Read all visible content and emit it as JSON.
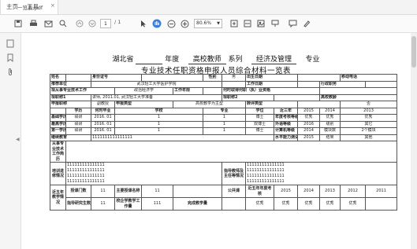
{
  "tabs": {
    "home": "主页",
    "tools": "工具",
    "doc": "一览表.pdf"
  },
  "toolbar": {
    "page_current": "1",
    "page_total": "/ 1",
    "zoom": "80.6%"
  },
  "icons": [
    "save-icon",
    "print-icon",
    "mail-icon",
    "search-icon",
    "page-up-icon",
    "page-down-icon",
    "select-cursor-icon",
    "hand-icon",
    "zoom-out-icon",
    "zoom-in-icon",
    "fit-page-icon",
    "fit-width-icon",
    "screenshot-icon",
    "annotate-icon",
    "comment-icon",
    "pen-icon",
    "pages-icon",
    "bookmark-icon",
    "attachment-icon"
  ],
  "document": {
    "title_line1": {
      "province": "湖北省",
      "year": "年度",
      "type": "高校教师",
      "series_label": "系列",
      "series": "经济及管理",
      "major_label": "专业"
    },
    "title_line2": "专业技术任职资格申报人员综合材料一览表",
    "labels": {
      "name": "姓名",
      "id_no": "身份证号",
      "gender": "性别",
      "birth": "出生日期",
      "mobile": "移动电话",
      "recommend_unit": "推荐单位",
      "work_unit": "工作日期",
      "admin_post": "行政职务",
      "current_unit": "现从事专业技术工作",
      "current_unit_val": "政治经济学",
      "work_years": "工作年限",
      "other_title": "何时取得何职（执）业资格",
      "present_title": "现职称1",
      "present_title2": "现职称2",
      "uni_title": "高校教龄",
      "apply_title": "申报职称",
      "apply_type": "申报类型",
      "declare_type": "申报类型",
      "transfer": "转评类型",
      "edu": "学历",
      "when_grad": "何时毕业",
      "school": "学校",
      "major": "专业",
      "degree": "学位",
      "last3": "近三年",
      "basic_edu": "基础学历",
      "highest_edu": "最高学历",
      "first_edu": "第一学历",
      "continue_edu": "继续教育",
      "annual_assess": "年度考核等级",
      "foreign": "外语等级",
      "computer": "计算机等级",
      "result": "结果",
      "level": "级别",
      "pass": "水平能力测试",
      "work_history": "从事专业技术工作简历",
      "training": "培训进修情况",
      "guide": "指导教师及主任等情况",
      "recent5": "近五年教学情况",
      "teach_count": "授课门数",
      "main_courses": "主要授课名称",
      "public_courses": "公共课",
      "guide_count": "指导研究生数",
      "research": "校企学教学工作量",
      "completed": "完成教学量",
      "teach_hours": "总量（课堂教学量）",
      "assess_recent": "近五年年度考核"
    },
    "values": {
      "recommend_unit": "武汉轻工大学医护学院",
      "present_title": "讲师, 2011.01, 武汉轻工大学准备",
      "apply_title": "副教授",
      "apply_type": "高校教学为主型",
      "gender": "男",
      "uni_years": "否",
      "year1": "2015",
      "year2": "2014",
      "year3": "2013",
      "basic_edu": {
        "edu": "硕研",
        "date": "2016. 01",
        "n": "1",
        "deg": "博士"
      },
      "highest_edu": {
        "edu": "硕研",
        "date": "2016. 01",
        "n": "1",
        "deg": "双博士"
      },
      "first_edu": {
        "edu": "硕研",
        "date": "2016. 01",
        "n": "1",
        "deg": "博士"
      },
      "assess": [
        "优秀",
        "优秀",
        "优秀"
      ],
      "foreign_vals": [
        "2016",
        "级别",
        "其它"
      ],
      "computer_vals": [
        "2014",
        "模块数",
        "2个模块"
      ],
      "pass_vals": [
        "2015",
        "结果",
        "其他"
      ],
      "continue_edu": "1111111111111111",
      "ones": "111111111111111",
      "count": "11",
      "main_course_count": "11",
      "guide_count": "11",
      "research_count": "111",
      "grades5": [
        "2015",
        "2014",
        "2013",
        "2012",
        "2011"
      ],
      "grade_vals": [
        "优秀",
        "优秀",
        "优秀",
        "优秀",
        "优秀"
      ]
    }
  }
}
